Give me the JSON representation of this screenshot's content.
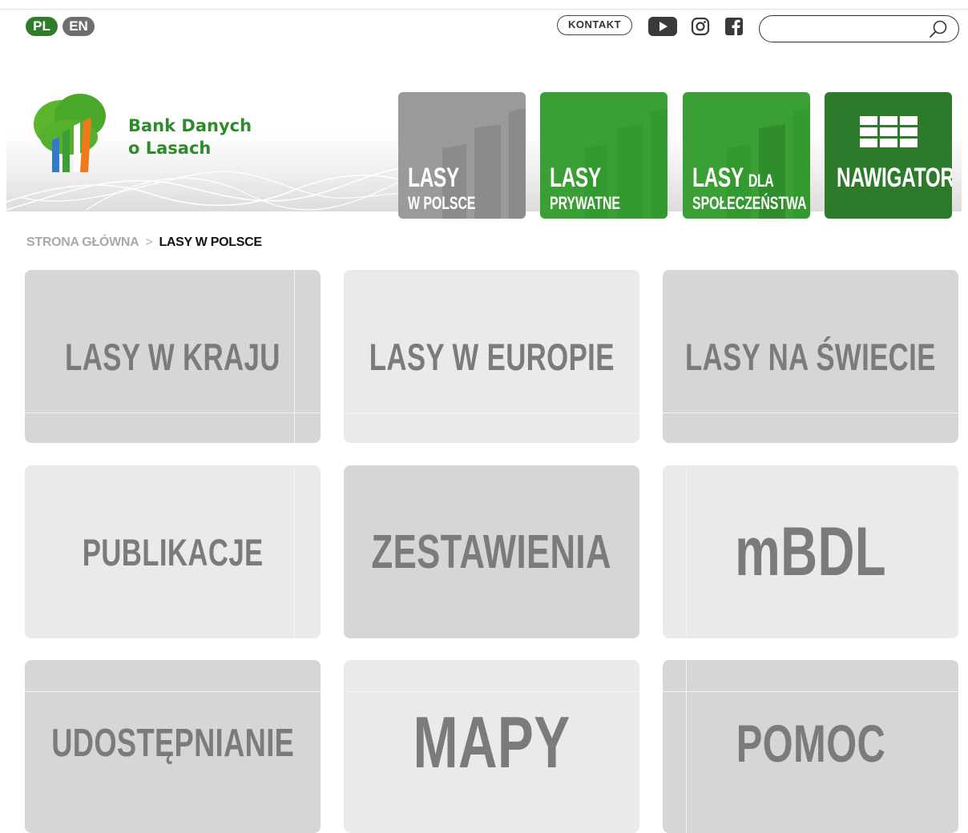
{
  "lang": {
    "pl": "PL",
    "en": "EN"
  },
  "top": {
    "contact": "KONTAKT",
    "search_placeholder": ""
  },
  "logo": {
    "line1": "Bank Danych",
    "line2": "o Lasach"
  },
  "nav": [
    {
      "title": "LASY",
      "subtitle": "W POLSCE"
    },
    {
      "title": "LASY",
      "subtitle": "PRYWATNE"
    },
    {
      "title": "LASY",
      "small": "DLA",
      "subtitle": "SPOŁECZEŃSTWA"
    },
    {
      "title": "NAWIGATOR"
    }
  ],
  "breadcrumb": {
    "home": "STRONA GŁÓWNA",
    "separator": ">",
    "current": "LASY W POLSCE"
  },
  "tiles": [
    {
      "label": "LASY W KRAJU"
    },
    {
      "label": "LASY W EUROPIE"
    },
    {
      "label": "LASY NA ŚWIECIE"
    },
    {
      "label": "PUBLIKACJE"
    },
    {
      "label": "ZESTAWIENIA"
    },
    {
      "label": "mBDL"
    },
    {
      "label": "UDOSTĘPNIANIE"
    },
    {
      "label": "MAPY"
    },
    {
      "label": "POMOC"
    }
  ],
  "colors": {
    "green": "#3aa035",
    "dark_green": "#2d7b2a",
    "gray": "#9a9a9a",
    "tile_text": "#7b7b7b"
  }
}
